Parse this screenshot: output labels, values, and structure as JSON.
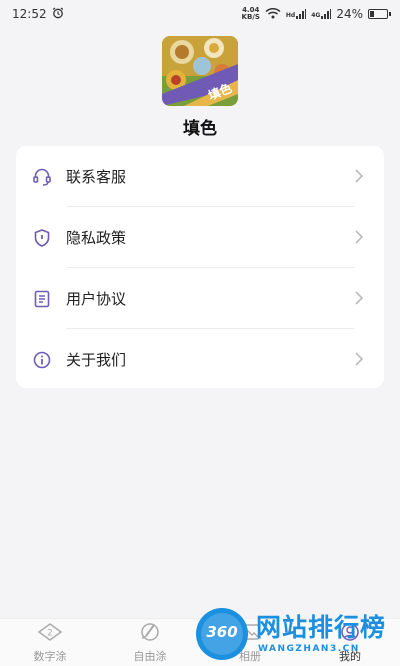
{
  "status_bar": {
    "time": "12:52",
    "net_speed_value": "4.04",
    "net_speed_unit": "KB/S",
    "signal_1": "Hd",
    "signal_2": "4G",
    "battery": "24%"
  },
  "app": {
    "name": "填色",
    "logo_badge": "填色"
  },
  "menu": {
    "items": [
      {
        "label": "联系客服",
        "icon": "headset-icon"
      },
      {
        "label": "隐私政策",
        "icon": "shield-icon"
      },
      {
        "label": "用户协议",
        "icon": "document-icon"
      },
      {
        "label": "关于我们",
        "icon": "info-icon"
      }
    ]
  },
  "bottom_nav": {
    "items": [
      {
        "label": "数字涂",
        "icon": "number-paint-icon"
      },
      {
        "label": "自由涂",
        "icon": "brush-icon"
      },
      {
        "label": "相册",
        "icon": "album-icon"
      },
      {
        "label": "我的",
        "icon": "user-icon"
      }
    ],
    "active_index": 3
  },
  "watermark": {
    "logo_number": "360",
    "title": "网站排行榜",
    "url": "WANGZHAN3.CN"
  },
  "colors": {
    "accent": "#6f5bb5",
    "background": "#f4f4f6",
    "watermark_blue": "#1b8fe0"
  }
}
